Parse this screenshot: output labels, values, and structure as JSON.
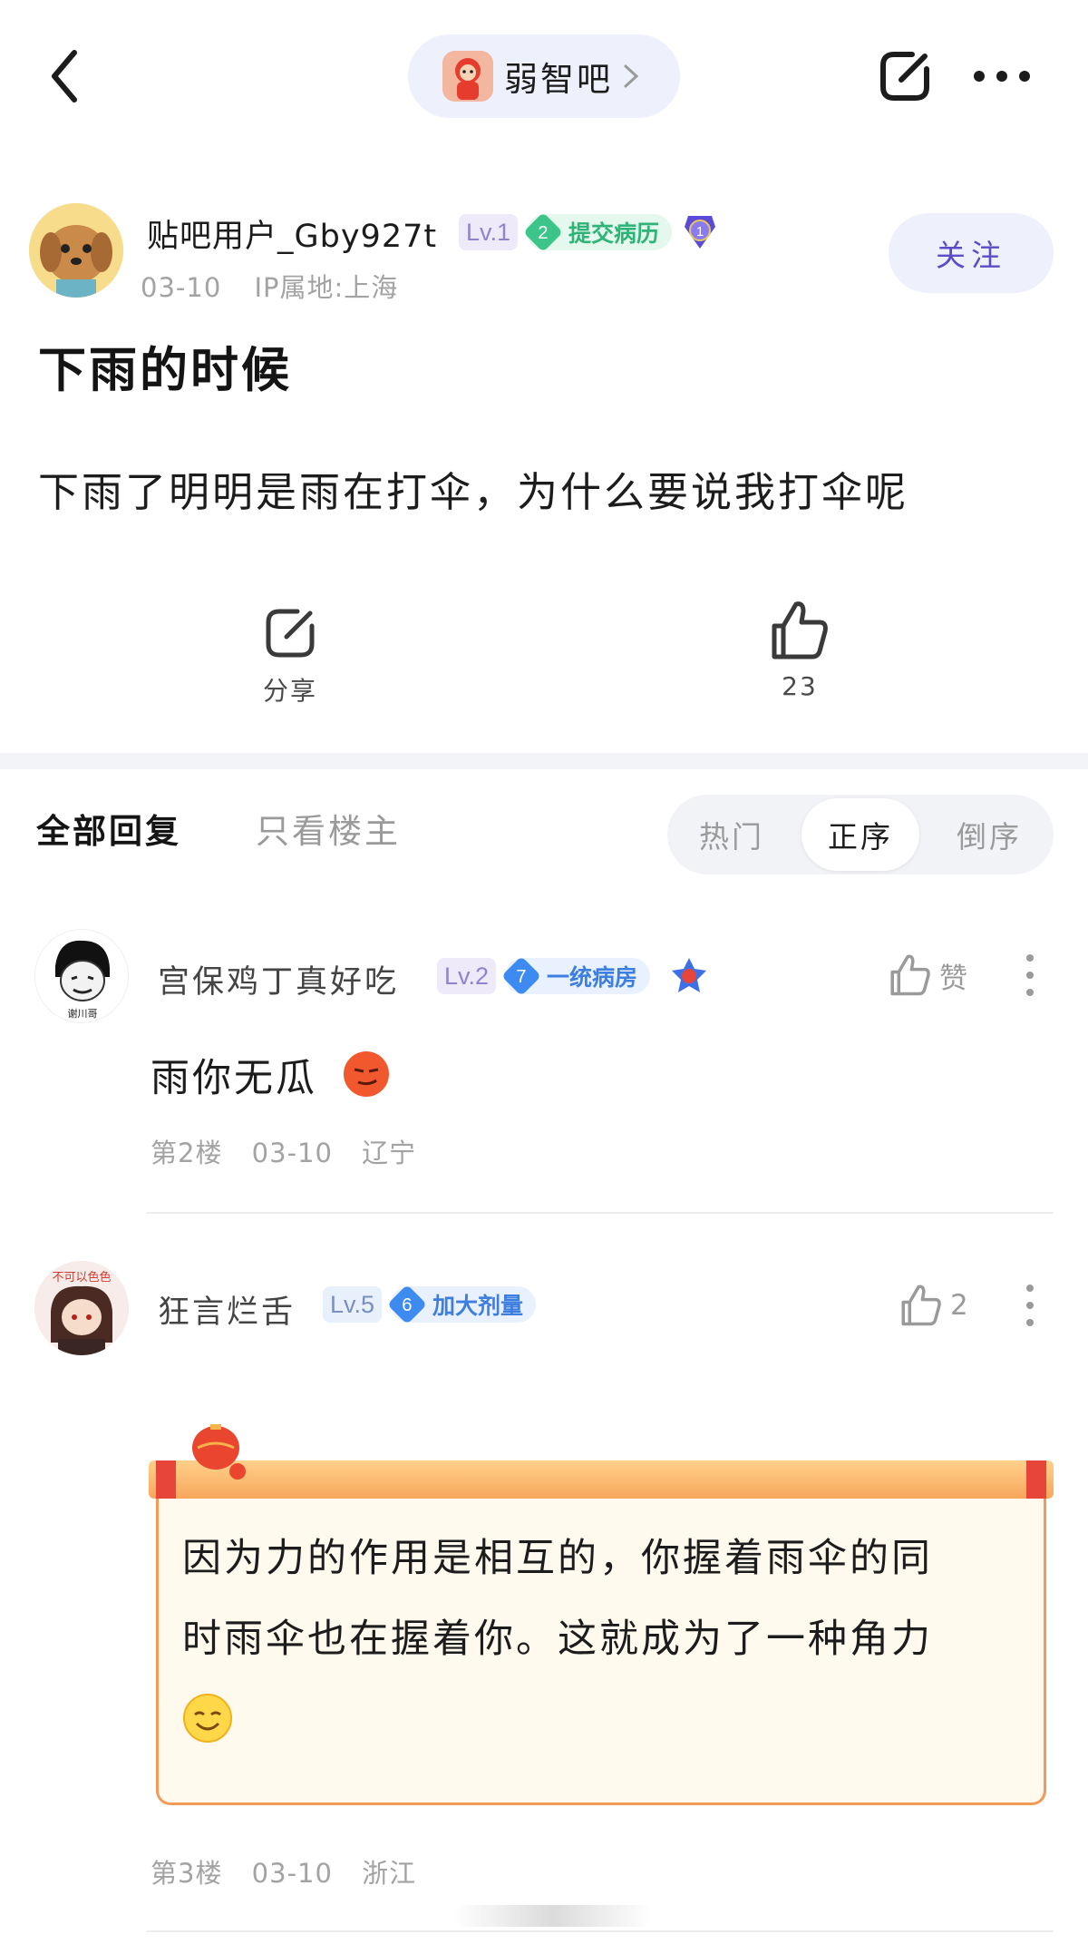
{
  "nav": {
    "forum_name": "弱智吧"
  },
  "post": {
    "author": {
      "name": "贴吧用户_Gby927t",
      "level": "Lv.1",
      "title_badge": {
        "number": "2",
        "text": "提交病历",
        "color": "#3cc58a"
      },
      "medal_number": "1"
    },
    "date": "03-10",
    "ip_location": "IP属地:上海",
    "follow_label": "关注",
    "title": "下雨的时候",
    "body": "下雨了明明是雨在打伞，为什么要说我打伞呢",
    "share_label": "分享",
    "like_count": "23"
  },
  "tabs": {
    "all_replies": "全部回复",
    "op_only": "只看楼主",
    "sort_options": [
      "热门",
      "正序",
      "倒序"
    ],
    "sort_selected": "正序"
  },
  "replies": [
    {
      "author": "宫保鸡丁真好吃",
      "level": "Lv.2",
      "title_badge": {
        "number": "7",
        "text": "一统病房",
        "color": "#3d8af0"
      },
      "avatar_caption": "谢川哥",
      "like_label": "赞",
      "text": "雨你无瓜",
      "floor": "第2楼",
      "date": "03-10",
      "location": "辽宁"
    },
    {
      "author": "狂言烂舌",
      "level": "Lv.5",
      "title_badge": {
        "number": "6",
        "text": "加大剂量",
        "color": "#3d8af0"
      },
      "avatar_caption": "不可以色色",
      "like_count": "2",
      "text_lines": [
        "因为力的作用是相互的，你握着雨伞的同",
        "时雨伞也在握着你。这就成为了一种角力"
      ],
      "floor": "第3楼",
      "date": "03-10",
      "location": "浙江"
    }
  ],
  "colors": {
    "accent_purple": "#5a4dc7",
    "pill_bg": "#eef0fb",
    "scroll_border": "#f39a59",
    "scroll_paper": "#fff9ee"
  }
}
